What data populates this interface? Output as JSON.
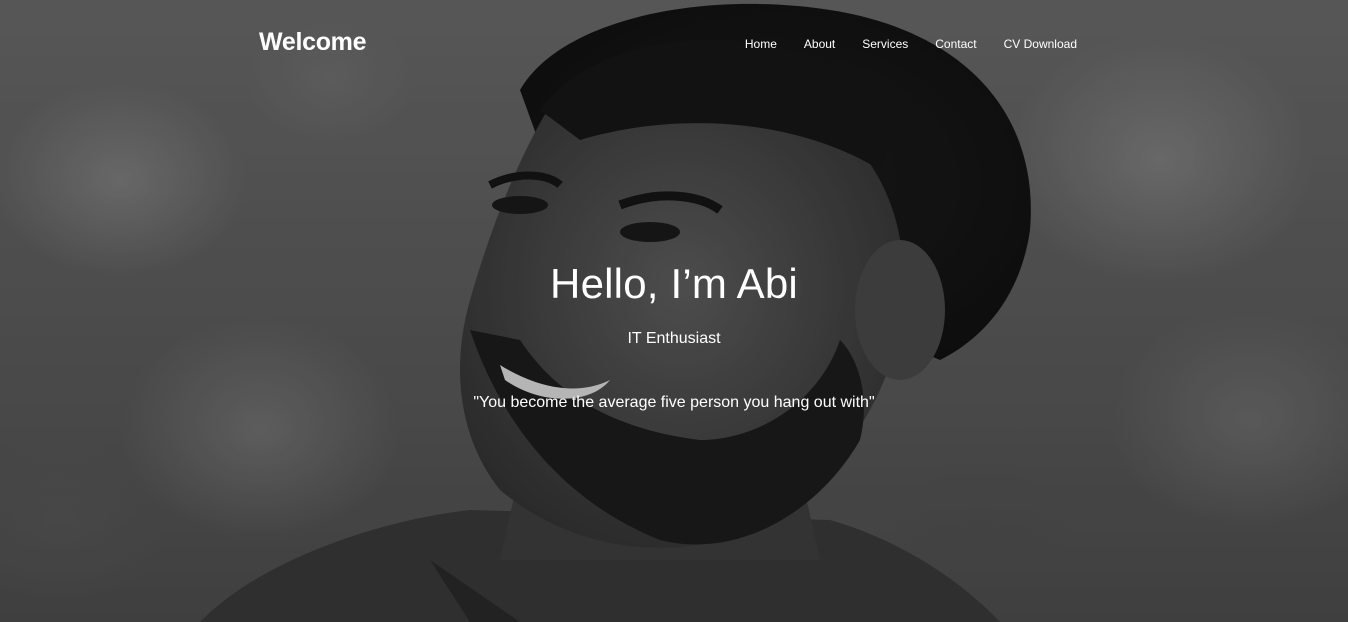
{
  "navbar": {
    "brand": "Welcome",
    "links": [
      {
        "label": "Home"
      },
      {
        "label": "About"
      },
      {
        "label": "Services"
      },
      {
        "label": "Contact"
      },
      {
        "label": "CV Download"
      }
    ]
  },
  "hero": {
    "title": "Hello, I’m Abi",
    "subtitle": "IT Enthusiast",
    "quote": "\"You become the average five person you hang out with\""
  },
  "colors": {
    "text": "#ffffff",
    "background": "#5f5f5f"
  }
}
